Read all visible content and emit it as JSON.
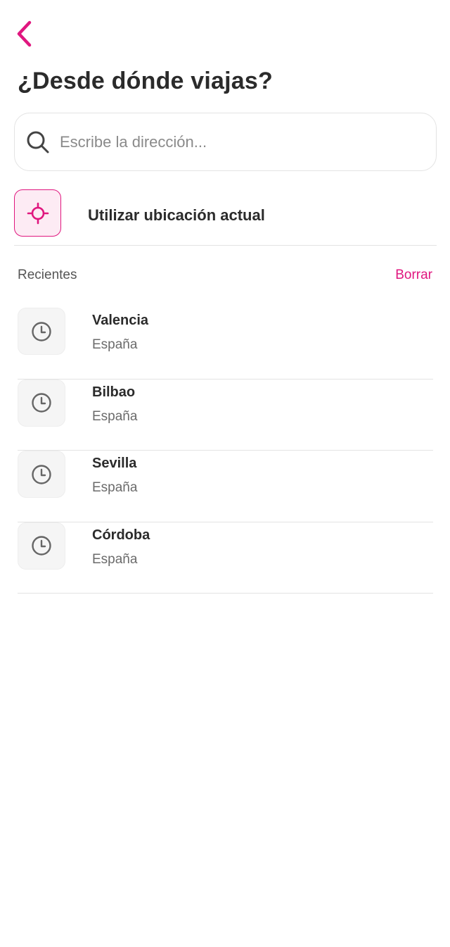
{
  "header": {
    "title": "¿Desde dónde viajas?"
  },
  "search": {
    "placeholder": "Escribe la dirección...",
    "value": ""
  },
  "current_location": {
    "label": "Utilizar ubicación actual"
  },
  "recents": {
    "title": "Recientes",
    "clear_label": "Borrar",
    "items": [
      {
        "name": "Valencia",
        "country": "España"
      },
      {
        "name": "Bilbao",
        "country": "España"
      },
      {
        "name": "Sevilla",
        "country": "España"
      },
      {
        "name": "Córdoba",
        "country": "España"
      }
    ]
  },
  "colors": {
    "accent": "#e0177f",
    "accent_bg": "#fdebf4",
    "text": "#2b2b2b",
    "muted": "#6b6b6b",
    "divider": "#e3e3e3",
    "icon_gray": "#666666"
  },
  "icons": {
    "back": "chevron-left-icon",
    "search": "search-icon",
    "location": "crosshair-icon",
    "recent": "clock-icon"
  }
}
